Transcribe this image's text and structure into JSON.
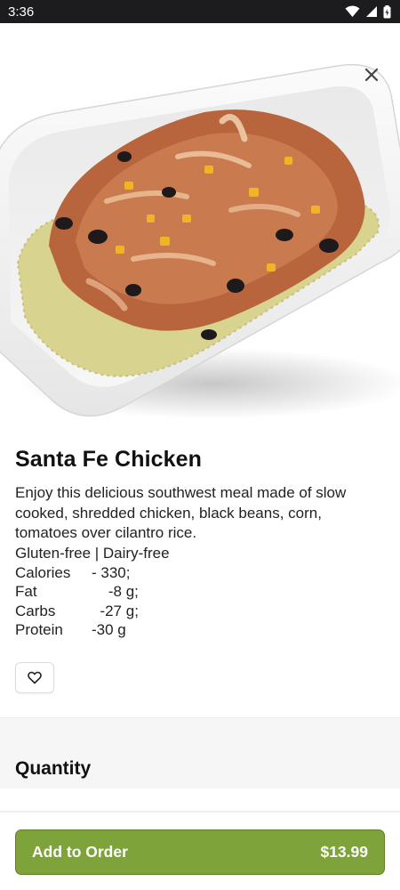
{
  "status_bar": {
    "time": "3:36"
  },
  "item": {
    "title": "Santa Fe Chicken",
    "description": "Enjoy this delicious southwest meal made of slow cooked, shredded chicken, black beans, corn, tomatoes over cilantro rice.",
    "tags": "Gluten-free | Dairy-free",
    "nutrition": [
      {
        "label": "Calories",
        "value": "- 330;"
      },
      {
        "label": "Fat",
        "value": "    -8 g;"
      },
      {
        "label": "Carbs",
        "value": "  -27 g;"
      },
      {
        "label": "Protein",
        "value": "-30 g"
      }
    ]
  },
  "quantity": {
    "title": "Quantity"
  },
  "cta": {
    "label": "Add to Order",
    "price": "$13.99"
  },
  "colors": {
    "accent": "#7ea33a",
    "status_bar": "#1c1c1e"
  },
  "icons": {
    "close": "close-icon",
    "favorite": "heart-icon"
  }
}
